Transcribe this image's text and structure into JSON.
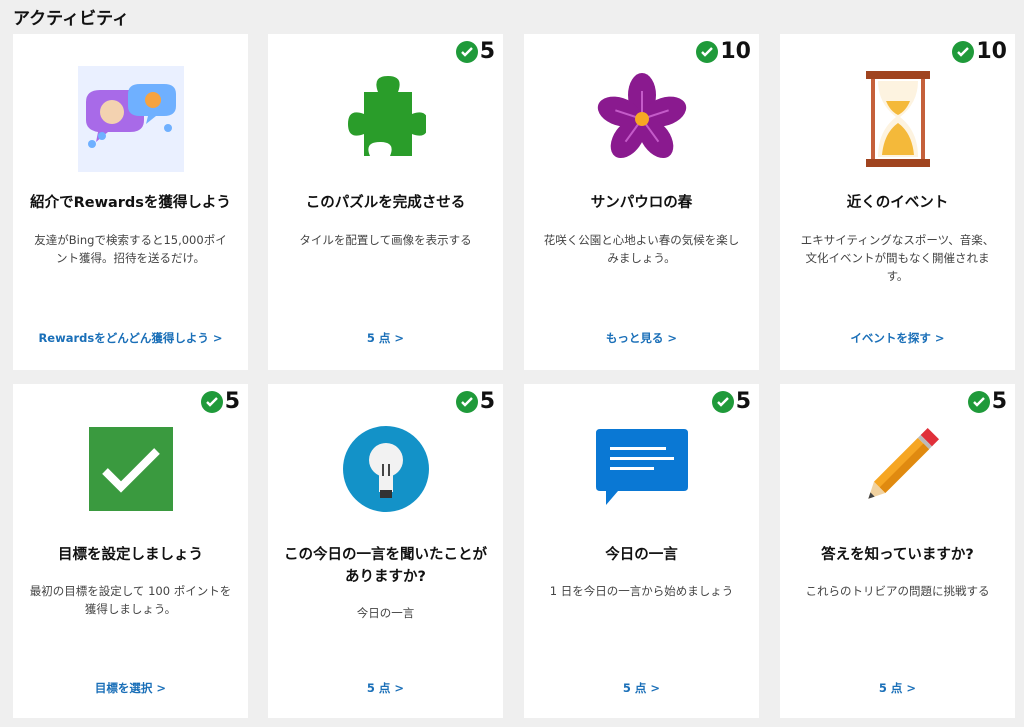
{
  "page": {
    "title": "アクティビティ"
  },
  "colors": {
    "check_green": "#1f9a3a",
    "link_blue": "#1a6fb8"
  },
  "cards": [
    {
      "title": "紹介でRewardsを獲得しよう",
      "desc": "友達がBingで検索すると15,000ポイント獲得。招待を送るだけ。",
      "link": "Rewardsをどんどん獲得しよう >",
      "badge": null,
      "icon": "chat-bubbles-illustration"
    },
    {
      "title": "このパズルを完成させる",
      "desc": "タイルを配置して画像を表示する",
      "link": "5 点 >",
      "badge": "5",
      "icon": "puzzle-piece-icon"
    },
    {
      "title": "サンパウロの春",
      "desc": "花咲く公園と心地よい春の気候を楽しみましょう。",
      "link": "もっと見る >",
      "badge": "10",
      "icon": "flower-icon"
    },
    {
      "title": "近くのイベント",
      "desc": "エキサイティングなスポーツ、音楽、文化イベントが間もなく開催されます。",
      "link": "イベントを探す >",
      "badge": "10",
      "icon": "hourglass-icon"
    },
    {
      "title": "目標を設定しましょう",
      "desc": "最初の目標を設定して 100 ポイントを獲得しましょう。",
      "link": "目標を選択 >",
      "badge": "5",
      "icon": "checkbox-icon"
    },
    {
      "title": "この今日の一言を聞いたことがありますか?",
      "desc": "今日の一言",
      "link": "5 点 >",
      "badge": "5",
      "icon": "lightbulb-icon"
    },
    {
      "title": "今日の一言",
      "desc": "1 日を今日の一言から始めましょう",
      "link": "5 点 >",
      "badge": "5",
      "icon": "message-icon"
    },
    {
      "title": "答えを知っていますか?",
      "desc": "これらのトリビアの問題に挑戦する",
      "link": "5 点 >",
      "badge": "5",
      "icon": "pencil-icon"
    }
  ]
}
